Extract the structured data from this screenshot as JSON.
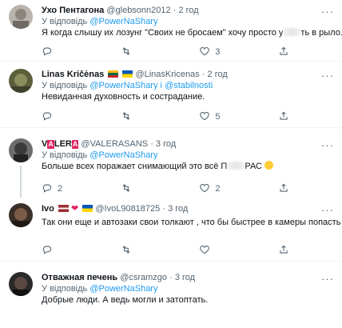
{
  "tweets": [
    {
      "name": "Ухо Пентагона",
      "handle": "@glebsonn2012",
      "time": "2 год",
      "reply_prefix": "У відповідь",
      "mentions": [
        "@PowerNaShary"
      ],
      "text_before": "Я когда слышу их лозунг \"Своих не бросаем\" хочу просто у",
      "text_after": "ть в рыло.",
      "replies": "",
      "retweets": "",
      "likes": "3"
    },
    {
      "name": "Linas Kričėnas",
      "handle": "@LinasKricenas",
      "time": "2 год",
      "reply_prefix": "У відповідь",
      "mentions": [
        "@PowerNaShary",
        "@stabilnosti"
      ],
      "mention_joiner": "і",
      "text": "Невиданная духовность и сострадание.",
      "replies": "",
      "retweets": "",
      "likes": "5"
    },
    {
      "name_parts": [
        "V",
        "A",
        "LER",
        "A"
      ],
      "handle": "@VALERASANS",
      "time": "3 год",
      "reply_prefix": "У відповідь",
      "mentions": [
        "@PowerNaShary"
      ],
      "text_before": "Больше всех поражает снимающий это всё П",
      "text_after": "РАС",
      "replies": "2",
      "retweets": "",
      "likes": "2"
    },
    {
      "name": "Ivo",
      "handle": "@IvoL90818725",
      "time": "3 год",
      "text": "Так они еще и автозаки свои толкают , что бы быстрее в камеры попасть",
      "replies": "",
      "retweets": "",
      "likes": ""
    },
    {
      "name": "Отважная печень",
      "handle": "@csramzgo",
      "time": "3 год",
      "reply_prefix": "У відповідь",
      "mentions": [
        "@PowerNaShary"
      ],
      "text": "Добрые люди. А ведь могли и затоптать."
    }
  ],
  "more_label": "···",
  "dot": "·",
  "colors": {
    "accent": "#1d9bf0",
    "muted": "#536471",
    "red": "#e0245e"
  },
  "icons": [
    "reply-icon",
    "retweet-icon",
    "like-icon",
    "share-icon"
  ]
}
